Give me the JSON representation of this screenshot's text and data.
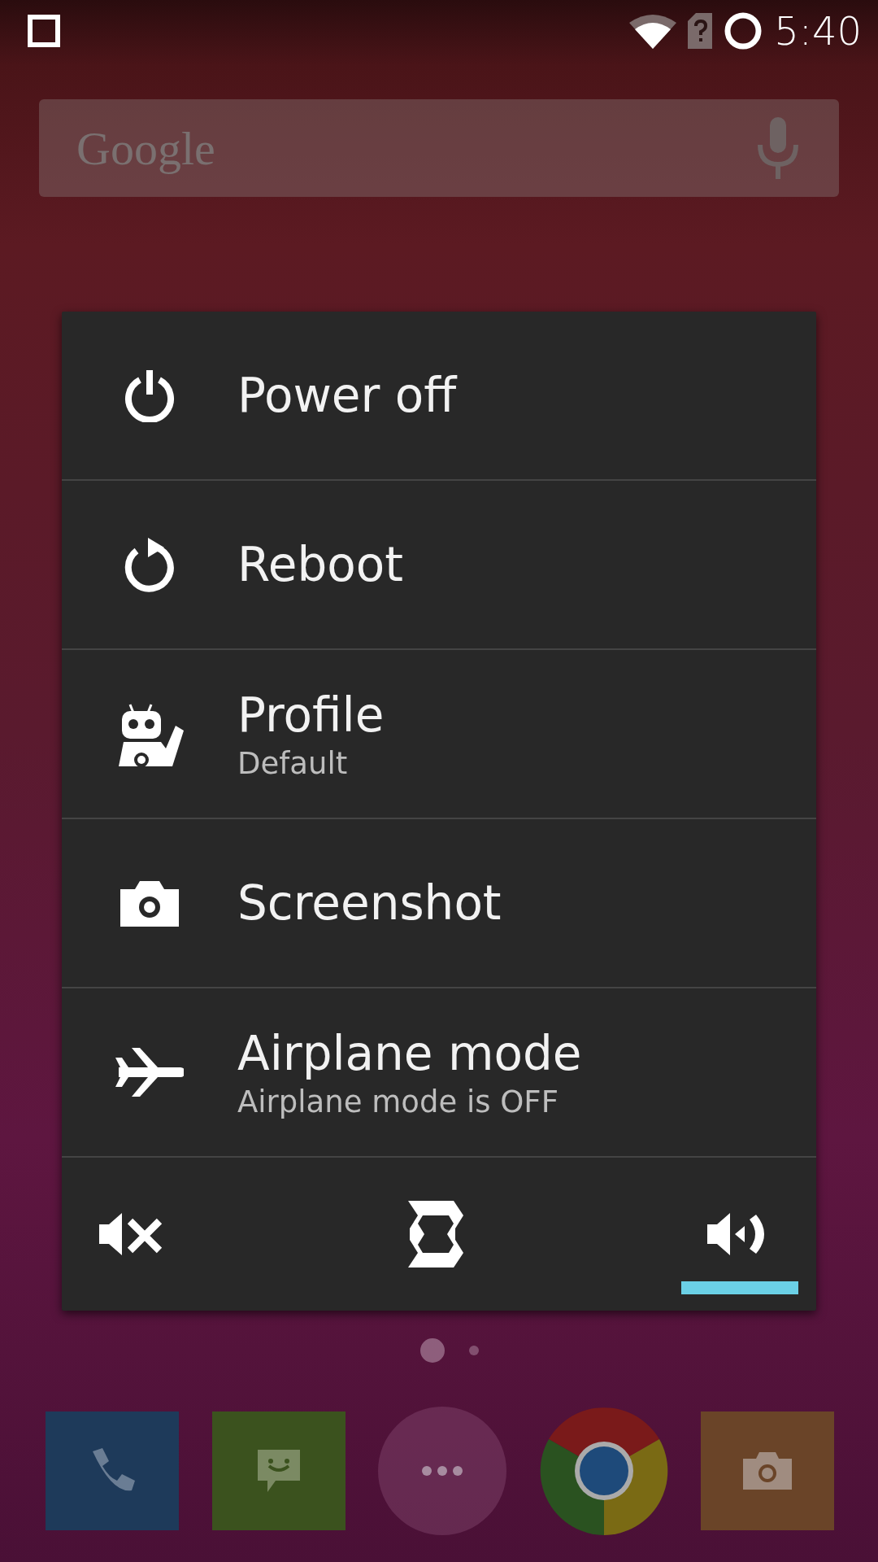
{
  "status_bar": {
    "time": "5:40"
  },
  "search_bar": {
    "logo": "Google"
  },
  "power_menu": {
    "items": [
      {
        "kind": "power",
        "title": "Power off"
      },
      {
        "kind": "reboot",
        "title": "Reboot"
      },
      {
        "kind": "profile",
        "title": "Profile",
        "subtitle": "Default"
      },
      {
        "kind": "screenshot",
        "title": "Screenshot"
      },
      {
        "kind": "airplane",
        "title": "Airplane mode",
        "subtitle": "Airplane mode is OFF"
      }
    ],
    "sound_modes": [
      {
        "kind": "silent",
        "selected": false
      },
      {
        "kind": "vibrate",
        "selected": false
      },
      {
        "kind": "normal",
        "selected": true
      }
    ]
  },
  "page_indicator": [
    {
      "selected": true
    },
    {
      "selected": false
    }
  ],
  "dock": [
    {
      "kind": "phone"
    },
    {
      "kind": "messaging"
    },
    {
      "kind": "apps"
    },
    {
      "kind": "browser"
    },
    {
      "kind": "camera"
    }
  ]
}
